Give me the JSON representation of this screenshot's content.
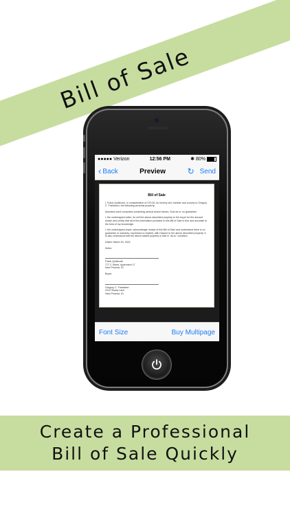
{
  "banner_top": {
    "text": "Bill of Sale"
  },
  "status_bar": {
    "carrier": "●●●●● Verizon",
    "time": "12:56 PM",
    "battery": "80%"
  },
  "nav": {
    "back_label": "Back",
    "title": "Preview",
    "send_label": "Send"
  },
  "document": {
    "title": "Bill of Sale",
    "paragraphs": [
      "I, Frank Quillecote, in consideration of 370.00, do hereby sell, transfer and convey to Gregory C. Frankston, the following personal property:",
      "Assorted used computers consisting various brand names. Sold as is, no guarantee.",
      "I, the undersigned seller, do sell the above described property to the buyer for the amount shown and certify that all of the information provided in this Bill of Sale is true and accurate to the best of my knowledge.",
      "I, the undersigned buyer, acknowledge receipt of this Bill of Sale and understand there is no guarantee or warranty, expressed or implied, with respect to the above described property. It is also understood that the above-stated property is sold in \"as-is\" condition.",
      "Dated: March 20, 2015"
    ],
    "seller_label": "Seller:",
    "seller_lines": [
      "Frank Quillecote",
      "777 C Street, Apartment 17",
      "New Phoenix, ID"
    ],
    "buyer_label": "Buyer:",
    "buyer_lines": [
      "Gregory C. Frankston",
      "2222 Shady Lane",
      "New Phoenix, ID"
    ]
  },
  "toolbar": {
    "font_size_label": "Font Size",
    "buy_multipage_label": "Buy Multipage"
  },
  "banner_bottom": {
    "line1": "Create a Professional",
    "line2": "Bill of Sale Quickly"
  },
  "colors": {
    "accent": "#1a7cf5",
    "banner": "#c7dda0"
  }
}
